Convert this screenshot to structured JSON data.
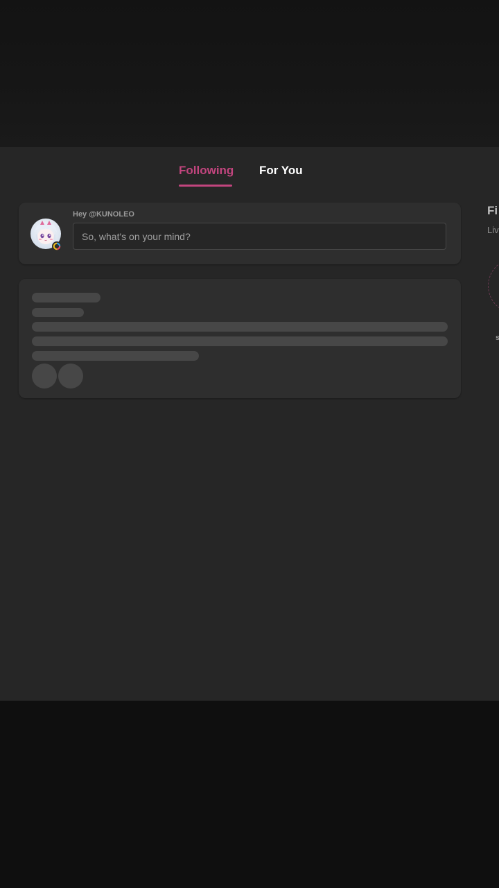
{
  "tabs": {
    "following": "Following",
    "for_you": "For You",
    "active": "Following"
  },
  "composer": {
    "greeting": "Hey @KUNOLEO",
    "placeholder": "So, what's on your mind?",
    "avatar_icon": "anime-avatar-icon",
    "badge_icon": "status-ring-icon"
  },
  "sidebar_peek": {
    "title": "Fi",
    "subtitle": "Liv",
    "name_fragment": "s"
  },
  "colors": {
    "accent": "#c2457e",
    "panel_bg": "#262626",
    "card_bg": "#2e2e2e",
    "skeleton": "#474747",
    "page_bg": "#0f0f0f"
  }
}
